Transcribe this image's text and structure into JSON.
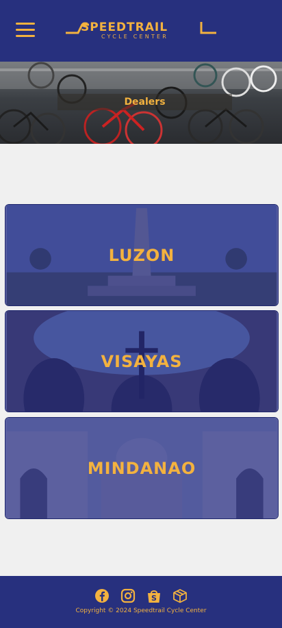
{
  "header": {
    "menu_icon": "hamburger-menu-icon",
    "logo": {
      "brand": "SPEEDTRAIL",
      "tagline": "CYCLE CENTER"
    }
  },
  "hero": {
    "title": "Dealers"
  },
  "regions": [
    {
      "label": "LUZON"
    },
    {
      "label": "VISAYAS"
    },
    {
      "label": "MINDANAO"
    }
  ],
  "footer": {
    "icons": [
      "facebook-icon",
      "instagram-icon",
      "shopee-icon",
      "box-icon"
    ],
    "copyright": "Copyright © 2024 Speedtrail Cycle Center"
  },
  "colors": {
    "navy": "#27307e",
    "accent": "#f3b23f",
    "page_bg": "#f0f0f0"
  }
}
